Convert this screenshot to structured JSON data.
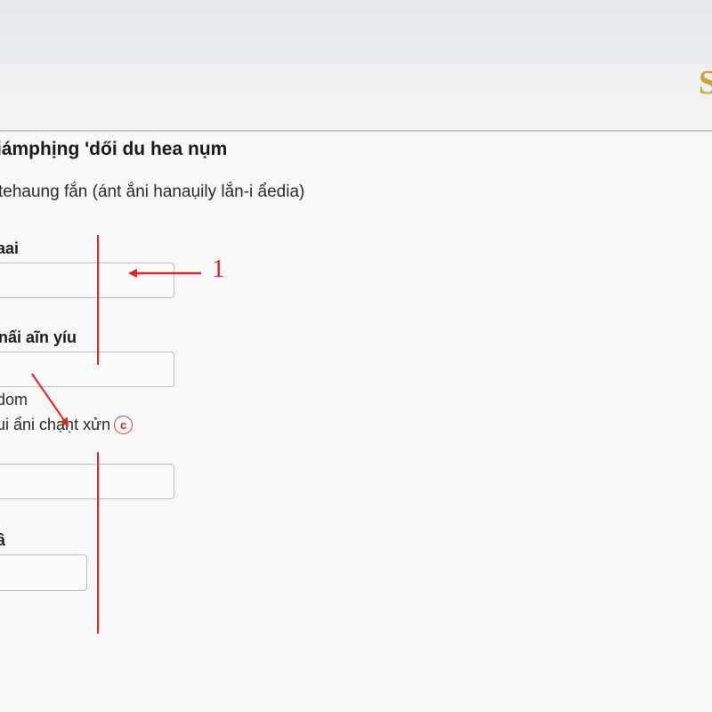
{
  "header": {
    "brand_text": "S"
  },
  "form": {
    "title": "iámphịng 'dői du hea nụm",
    "subtitle": "tehaung fắn (ánt ắni hanaụily lắn-i ẩedia)",
    "fields": [
      {
        "label": "aai"
      },
      {
        "label": "nấi aĩn yíu"
      },
      {
        "label": ""
      },
      {
        "label": "â"
      }
    ],
    "option_text_1": "dom",
    "option_text_2": "ui ẩni chạḥt xửn",
    "circle_glyph": "c"
  },
  "annotations": {
    "number_label": "1",
    "color": "#d82828"
  }
}
